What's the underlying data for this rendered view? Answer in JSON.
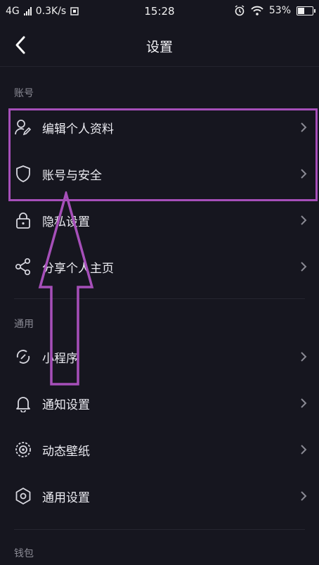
{
  "status": {
    "network": "4G",
    "speed": "0.3K/s",
    "time": "15:28",
    "battery": "53%",
    "battery_level": 0.53
  },
  "nav": {
    "title": "设置"
  },
  "sections": {
    "account": "账号",
    "general": "通用",
    "wallet": "钱包"
  },
  "items": {
    "edit_profile": "编辑个人资料",
    "account_security": "账号与安全",
    "privacy": "隐私设置",
    "share_profile": "分享个人主页",
    "mini_program": "小程序",
    "notification": "通知设置",
    "live_wallpaper": "动态壁纸",
    "general_settings": "通用设置"
  },
  "colors": {
    "background": "#16161f",
    "annotation": "#a64fb9"
  }
}
